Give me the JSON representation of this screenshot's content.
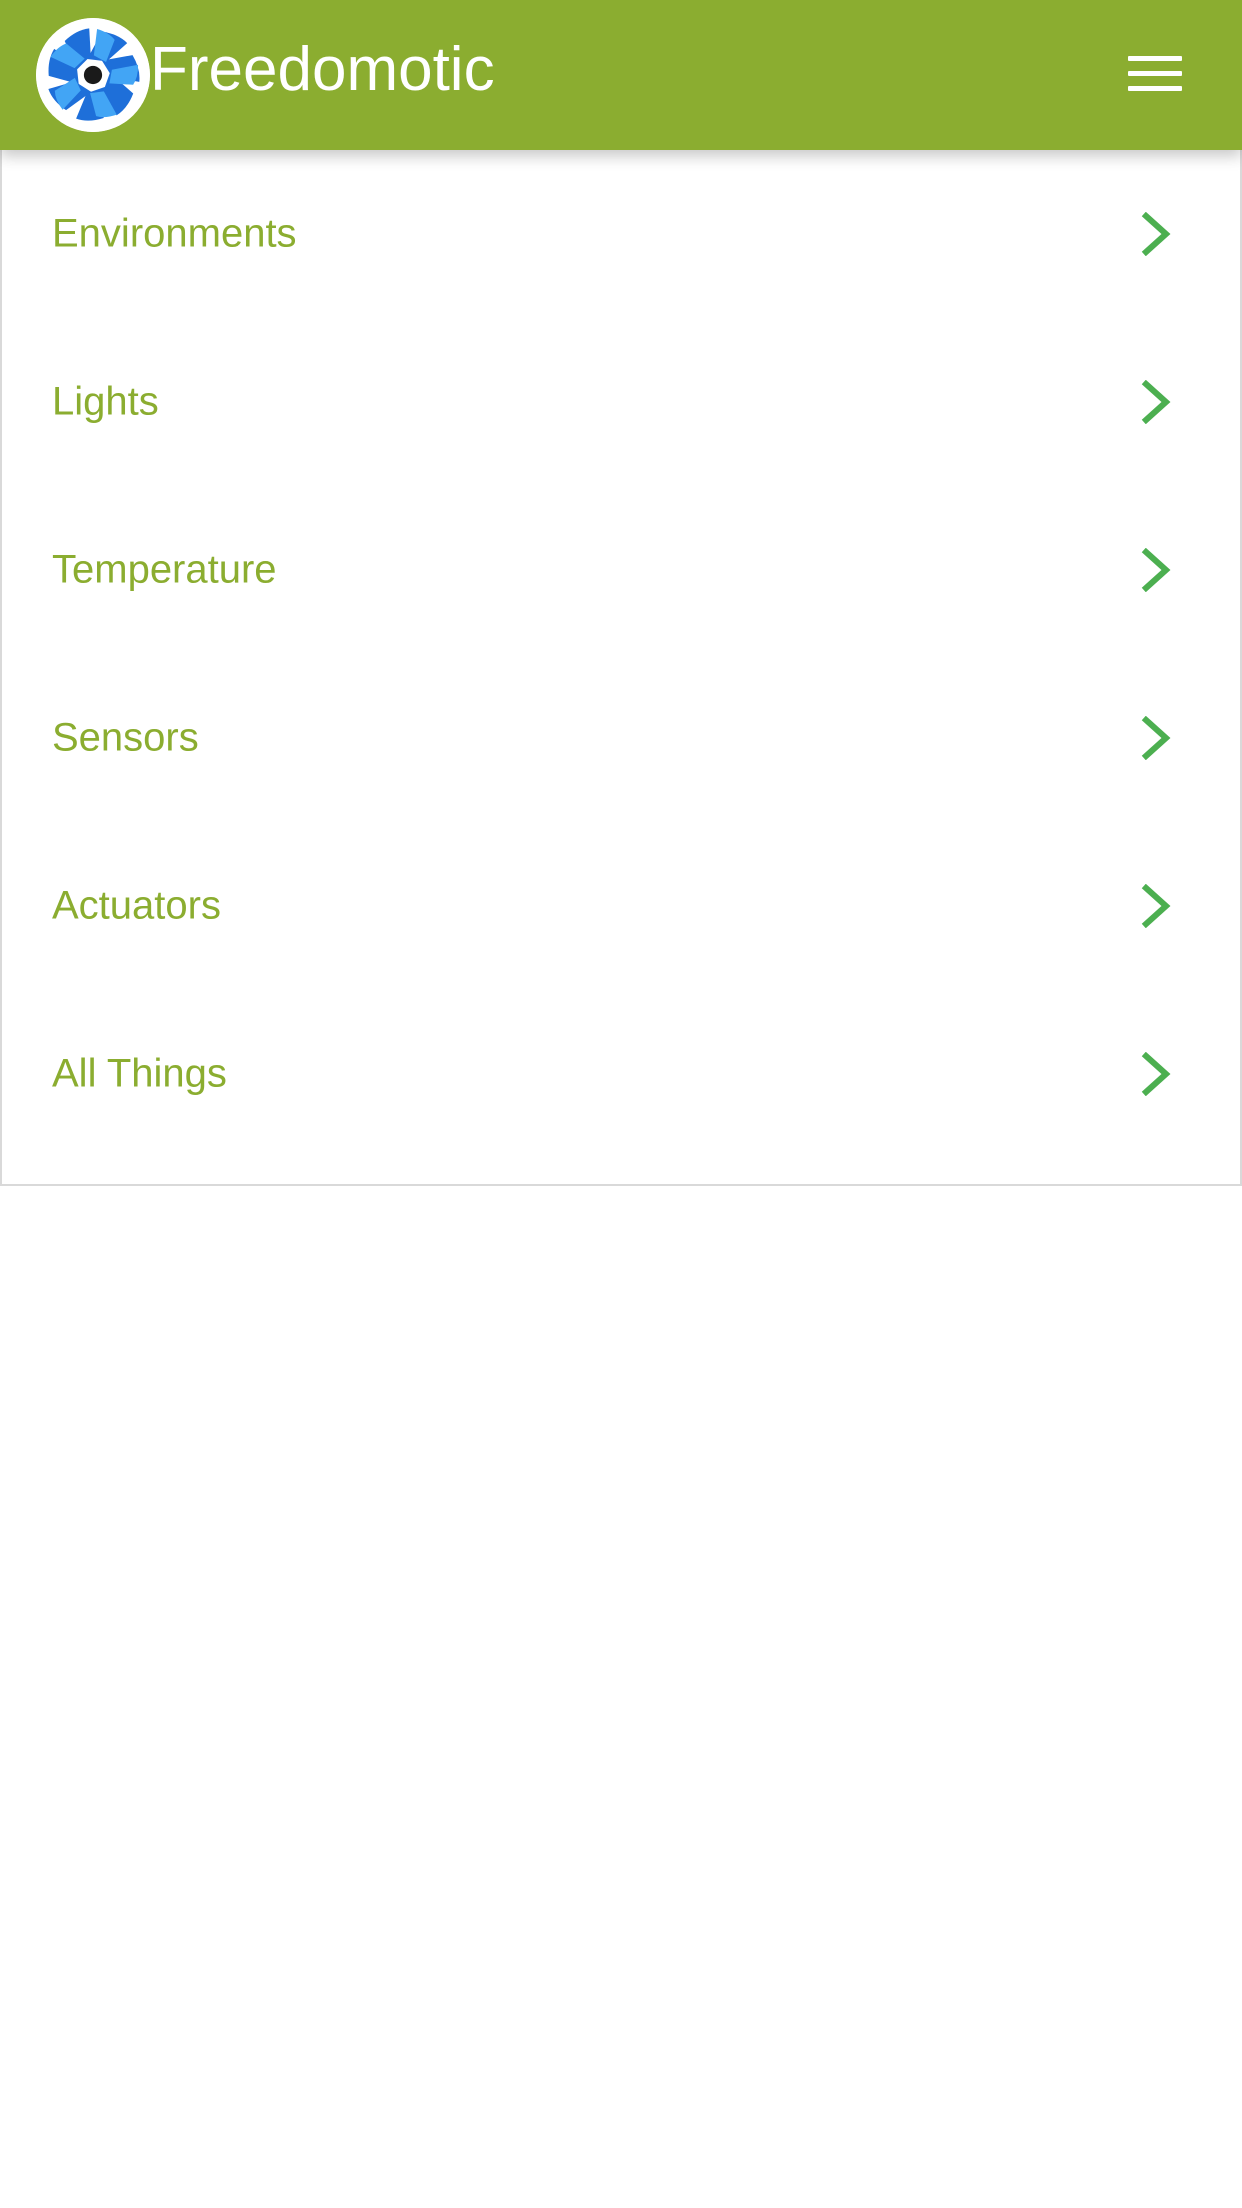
{
  "header": {
    "app_title": "Freedomotic",
    "logo_icon": "freedomotic-logo-icon",
    "menu_icon": "hamburger-menu-icon"
  },
  "nav": {
    "items": [
      {
        "label": "Environments",
        "icon": "chevron-right-icon"
      },
      {
        "label": "Lights",
        "icon": "chevron-right-icon"
      },
      {
        "label": "Temperature",
        "icon": "chevron-right-icon"
      },
      {
        "label": "Sensors",
        "icon": "chevron-right-icon"
      },
      {
        "label": "Actuators",
        "icon": "chevron-right-icon"
      },
      {
        "label": "All Things",
        "icon": "chevron-right-icon"
      }
    ]
  },
  "colors": {
    "header_background": "#8bad30",
    "item_label": "#8bad30",
    "chevron": "#4caf50",
    "logo_blue_dark": "#1e6fd9",
    "logo_blue_light": "#42a5f5",
    "logo_center": "#1a1a1a",
    "background": "#ffffff"
  }
}
